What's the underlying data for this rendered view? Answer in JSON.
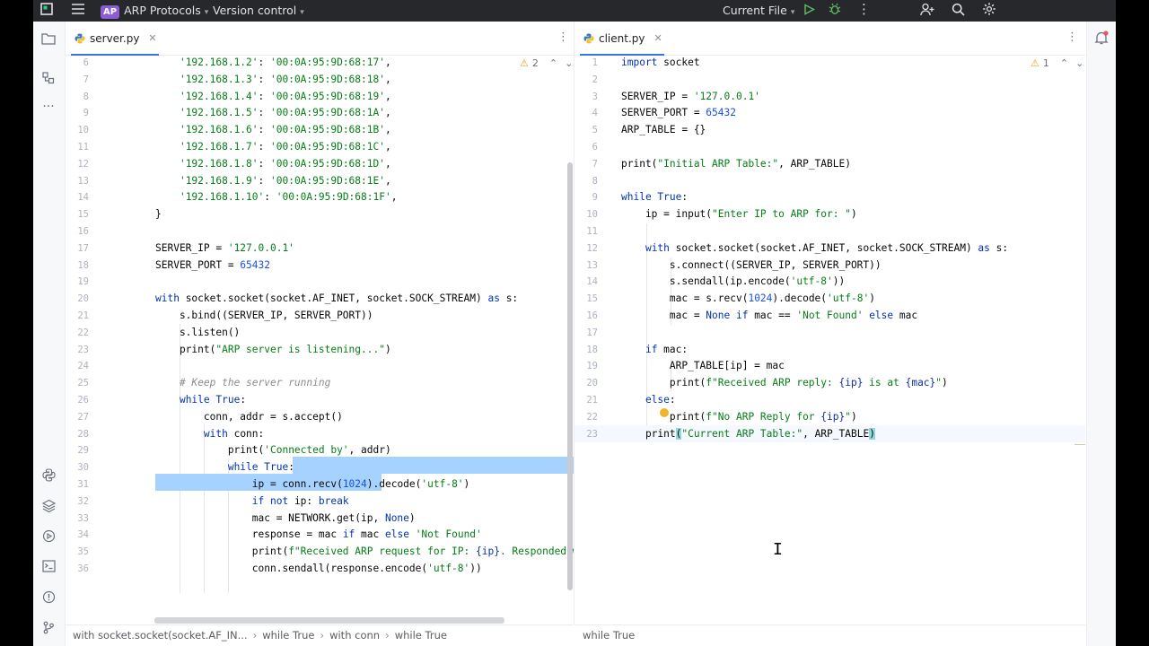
{
  "topbar": {
    "project_badge": "AP",
    "project_name": "ARP Protocols",
    "vcs": "Version control",
    "run_config": "Current File"
  },
  "icons": {
    "app": "app-logo-icon",
    "menu": "hamburger-icon",
    "run": "run-icon",
    "debug": "debug-icon",
    "more": "more-vertical-icon",
    "add_user": "add-user-icon",
    "search": "search-icon",
    "settings": "gear-icon"
  },
  "left_editor": {
    "tab_label": "server.py",
    "warnings": "2",
    "lines": [
      {
        "n": "6"
      },
      {
        "n": "7"
      },
      {
        "n": "8"
      },
      {
        "n": "9"
      },
      {
        "n": "10"
      },
      {
        "n": "11"
      },
      {
        "n": "12"
      },
      {
        "n": "13"
      },
      {
        "n": "14"
      },
      {
        "n": "15"
      },
      {
        "n": "16"
      },
      {
        "n": "17"
      },
      {
        "n": "18"
      },
      {
        "n": "19"
      },
      {
        "n": "20"
      },
      {
        "n": "21"
      },
      {
        "n": "22"
      },
      {
        "n": "23"
      },
      {
        "n": "24"
      },
      {
        "n": "25"
      },
      {
        "n": "26"
      },
      {
        "n": "27"
      },
      {
        "n": "28"
      },
      {
        "n": "29"
      },
      {
        "n": "30"
      },
      {
        "n": "31"
      },
      {
        "n": "32"
      },
      {
        "n": "33"
      },
      {
        "n": "34"
      },
      {
        "n": "35"
      },
      {
        "n": "36"
      }
    ],
    "breadcrumb": [
      "with socket.socket(socket.AF_IN...",
      "while True",
      "with conn",
      "while True"
    ]
  },
  "right_editor": {
    "tab_label": "client.py",
    "warnings": "1",
    "lines": [
      {
        "n": "1"
      },
      {
        "n": "2"
      },
      {
        "n": "3"
      },
      {
        "n": "4"
      },
      {
        "n": "5"
      },
      {
        "n": "6"
      },
      {
        "n": "7"
      },
      {
        "n": "8"
      },
      {
        "n": "9"
      },
      {
        "n": "10"
      },
      {
        "n": "11"
      },
      {
        "n": "12"
      },
      {
        "n": "13"
      },
      {
        "n": "14"
      },
      {
        "n": "15"
      },
      {
        "n": "16"
      },
      {
        "n": "17"
      },
      {
        "n": "18"
      },
      {
        "n": "19"
      },
      {
        "n": "20"
      },
      {
        "n": "21"
      },
      {
        "n": "22"
      },
      {
        "n": "23"
      }
    ],
    "breadcrumb": [
      "while True"
    ]
  },
  "colors": {
    "keyword": "#0033b3",
    "string": "#067d17",
    "number": "#1750eb",
    "comment": "#8c8c8c",
    "selection": "#a6d2ff",
    "accent": "#3574f0"
  }
}
